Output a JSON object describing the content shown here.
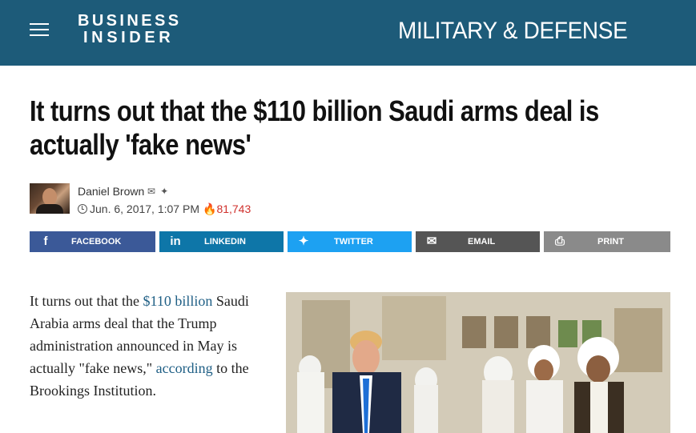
{
  "header": {
    "brand_line1": "BUSINESS",
    "brand_line2": "INSIDER",
    "section": "MILITARY & DEFENSE",
    "bg_color": "#1d5b79"
  },
  "article": {
    "headline": "It turns out that the $110 billion Saudi arms deal is actually 'fake news'",
    "author": "Daniel Brown",
    "date": "Jun. 6, 2017, 1:07 PM",
    "views": "81,743",
    "body": {
      "p1_a": "It turns out that the ",
      "link1": "$110 billion",
      "p1_b": " Saudi Arabia arms deal that the Trump administration announced in May is actually \"fake news,\" ",
      "link2": "according",
      "p1_c": " to the Brookings Institution."
    }
  },
  "share": {
    "facebook": "FACEBOOK",
    "linkedin": "LINKEDIN",
    "twitter": "TWITTER",
    "email": "EMAIL",
    "print": "PRINT"
  },
  "icons": {
    "menu": "hamburger-menu-icon",
    "mail": "envelope-icon",
    "twitter": "twitter-bird-icon",
    "clock": "clock-icon",
    "flame": "flame-icon"
  }
}
